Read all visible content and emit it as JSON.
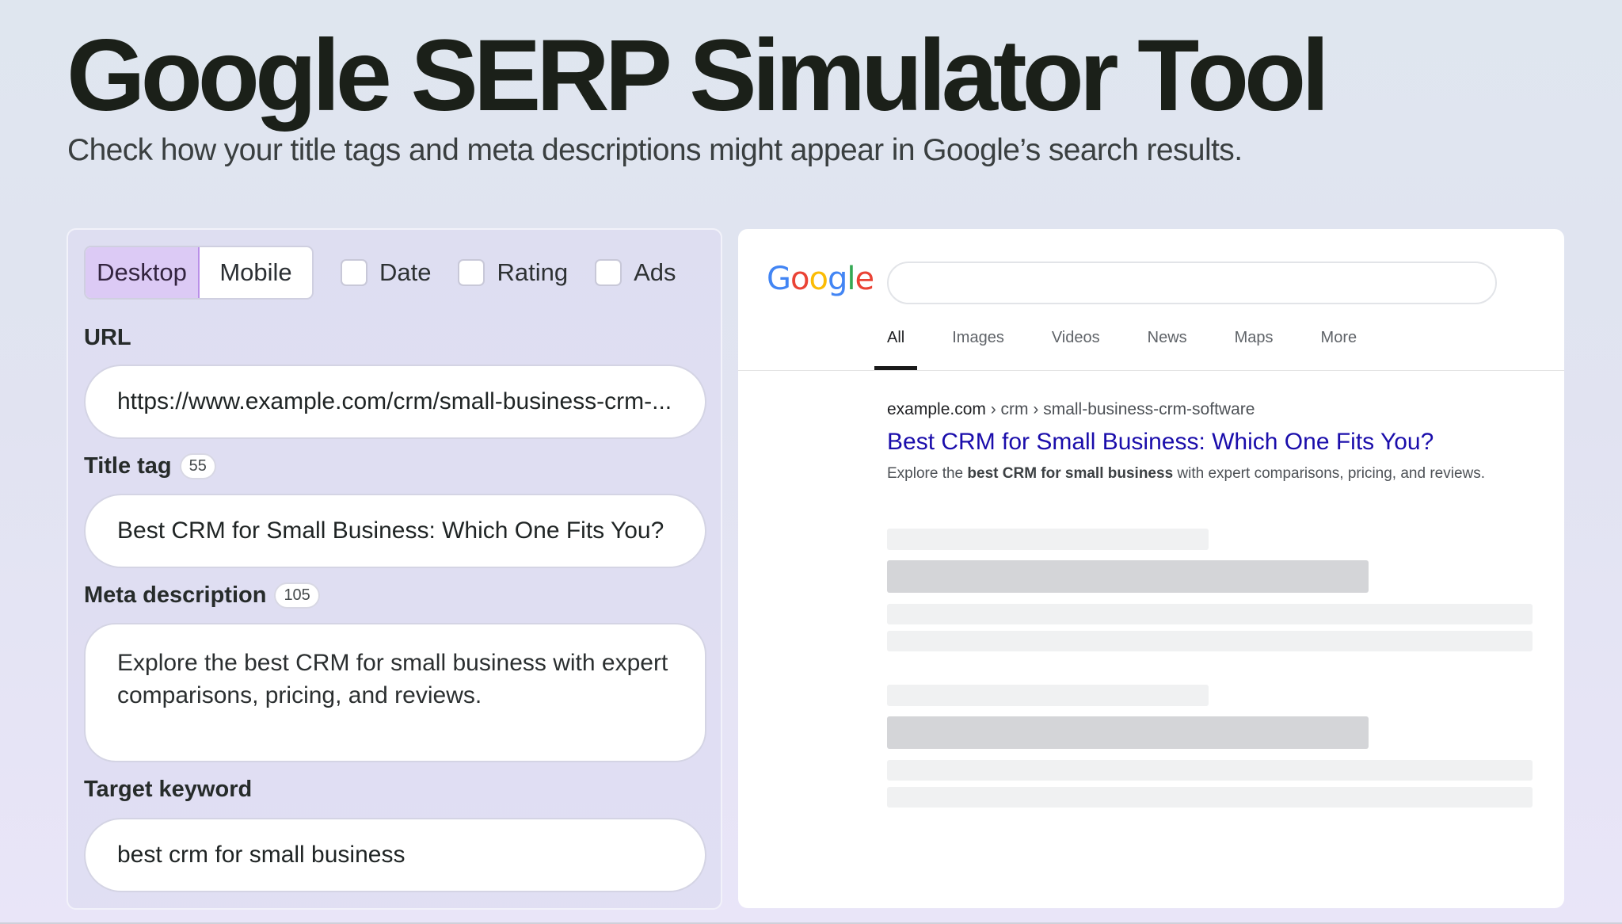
{
  "header": {
    "title": "Google SERP Simulator Tool",
    "subtitle": "Check how your title tags and meta descriptions might appear in Google’s search results."
  },
  "controls": {
    "devices": [
      {
        "label": "Desktop",
        "active": true
      },
      {
        "label": "Mobile",
        "active": false
      }
    ],
    "checkboxes": [
      {
        "label": "Date",
        "checked": false
      },
      {
        "label": "Rating",
        "checked": false
      },
      {
        "label": "Ads",
        "checked": false
      }
    ]
  },
  "form": {
    "url_label": "URL",
    "url_value": "https://www.example.com/crm/small-business-crm-...",
    "title_label": "Title tag",
    "title_count": "55",
    "title_value": "Best CRM for Small Business: Which One Fits You?",
    "meta_label": "Meta description",
    "meta_count": "105",
    "meta_value": "Explore the best CRM for small business with expert comparisons, pricing, and reviews.",
    "keyword_label": "Target keyword",
    "keyword_value": "best crm for small business"
  },
  "preview": {
    "logo_letters": [
      "G",
      "o",
      "o",
      "g",
      "l",
      "e"
    ],
    "tabs": [
      "All",
      "Images",
      "Videos",
      "News",
      "Maps",
      "More"
    ],
    "active_tab": "All",
    "breadcrumb_domain": "example.com",
    "breadcrumb_path": " › crm › small-business-crm-software",
    "result_title": "Best CRM for Small Business: Which One Fits You?",
    "snippet_before": "Explore the ",
    "snippet_bold": "best CRM for small business",
    "snippet_after": " with expert comparisons, pricing, and reviews."
  },
  "colors": {
    "active_toggle": "#dccaf5",
    "link_blue": "#1a0dab",
    "panel_lavender": "#dddcf2"
  }
}
